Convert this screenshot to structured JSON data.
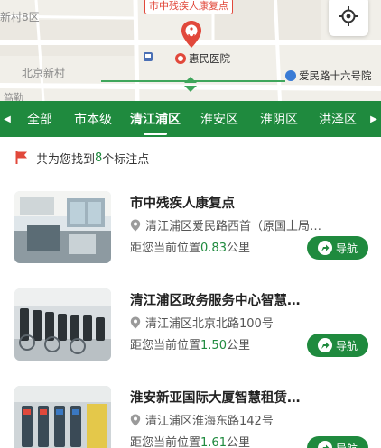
{
  "map": {
    "labels": {
      "district": "新村8区",
      "community": "北京新村",
      "partial_bottom": "笃勤"
    },
    "selected_poi": "市中残疾人康复点",
    "hospital": "惠民医院",
    "street": "爱民路十六号院"
  },
  "tabs": {
    "items": [
      {
        "label": "全部"
      },
      {
        "label": "市本级"
      },
      {
        "label": "清江浦区"
      },
      {
        "label": "淮安区"
      },
      {
        "label": "淮阴区"
      },
      {
        "label": "洪泽区"
      }
    ],
    "active_index": 2
  },
  "result": {
    "prefix": "共为您找到",
    "count": "8",
    "suffix": "个标注点"
  },
  "list": [
    {
      "title": "市中残疾人康复点",
      "address": "清江浦区爱民路西首（原国土局…",
      "dist_prefix": "距您当前位置",
      "dist_value": "0.83",
      "dist_unit": "公里",
      "nav_label": "导航"
    },
    {
      "title": "清江浦区政务服务中心智慧…",
      "address": "清江浦区北京北路100号",
      "dist_prefix": "距您当前位置",
      "dist_value": "1.50",
      "dist_unit": "公里",
      "nav_label": "导航"
    },
    {
      "title": "淮安新亚国际大厦智慧租赁…",
      "address": "清江浦区淮海东路142号",
      "dist_prefix": "距您当前位置",
      "dist_value": "1.61",
      "dist_unit": "公里",
      "nav_label": "导航"
    }
  ],
  "colors": {
    "brand_green": "#1f8a3e",
    "pin_red": "#e1483b"
  },
  "icons": {
    "locate": "crosshair-icon",
    "flag": "flag-icon",
    "location": "location-pin-icon",
    "navigate": "navigate-icon"
  }
}
